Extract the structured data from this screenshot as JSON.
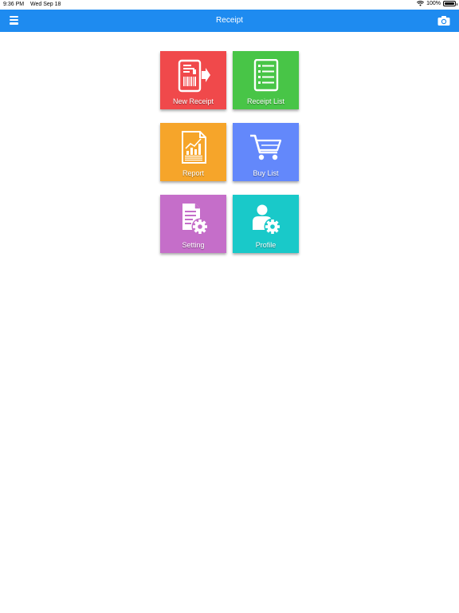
{
  "status_bar": {
    "time": "9:36 PM",
    "date": "Wed Sep 18",
    "battery": "100%",
    "battery_level": 1.0
  },
  "nav": {
    "title": "Receipt",
    "left_icon": "menu-icon",
    "right_icon": "camera-icon"
  },
  "tiles": [
    {
      "label": "New Receipt",
      "icon": "new-receipt-icon",
      "color": "#f0494b"
    },
    {
      "label": "Receipt List",
      "icon": "receipt-list-icon",
      "color": "#48c547"
    },
    {
      "label": "Report",
      "icon": "report-chart-icon",
      "color": "#f6a52a"
    },
    {
      "label": "Buy List",
      "icon": "shopping-cart-icon",
      "color": "#6388fb"
    },
    {
      "label": "Setting",
      "icon": "document-gear-icon",
      "color": "#c56ec9"
    },
    {
      "label": "Profile",
      "icon": "user-gear-icon",
      "color": "#19c9c9"
    }
  ],
  "colors": {
    "nav_bar": "#1e8bf0",
    "background": "#ffffff"
  }
}
